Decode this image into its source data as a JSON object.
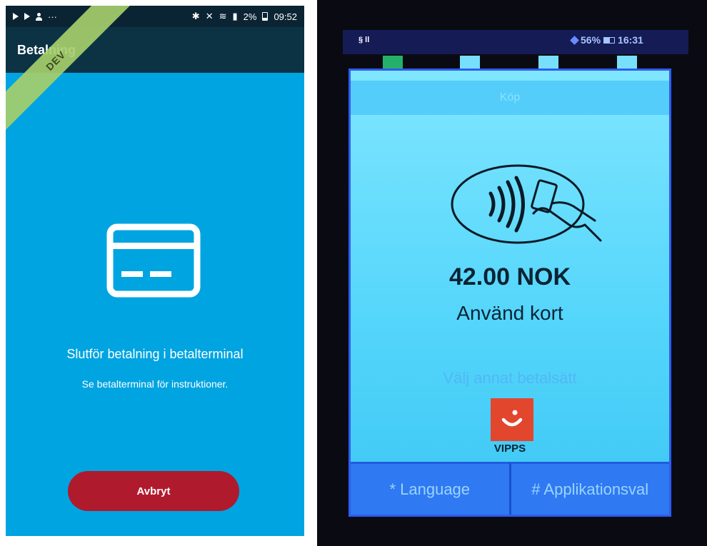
{
  "phone": {
    "status": {
      "overflow": "···",
      "battery": "2%",
      "time": "09:52"
    },
    "appbar_title": "Betalning",
    "dev_ribbon": "DEV",
    "icon": "credit-card-icon",
    "headline": "Slutför betalning i betalterminal",
    "subline": "Se betalterminal för instruktioner.",
    "cancel_label": "Avbryt",
    "colors": {
      "background": "#00a4e1",
      "appbar": "#0b3344",
      "cancel": "#b01a2d"
    }
  },
  "terminal": {
    "status_left": "§ ll",
    "battery": "56%",
    "time": "16:31",
    "header": "Köp",
    "icon": "contactless-card-icon",
    "amount": "42.00 NOK",
    "instruction": "Använd kort",
    "alt_payment": "Välj annat betalsätt",
    "vipps_label": "VIPPS",
    "softkeys": [
      {
        "label": "* Language"
      },
      {
        "label": "# Applikationsval"
      }
    ],
    "colors": {
      "screen": "#55d6fb",
      "softkeys": "#2f79f3",
      "vipps": "#e2462d"
    }
  }
}
